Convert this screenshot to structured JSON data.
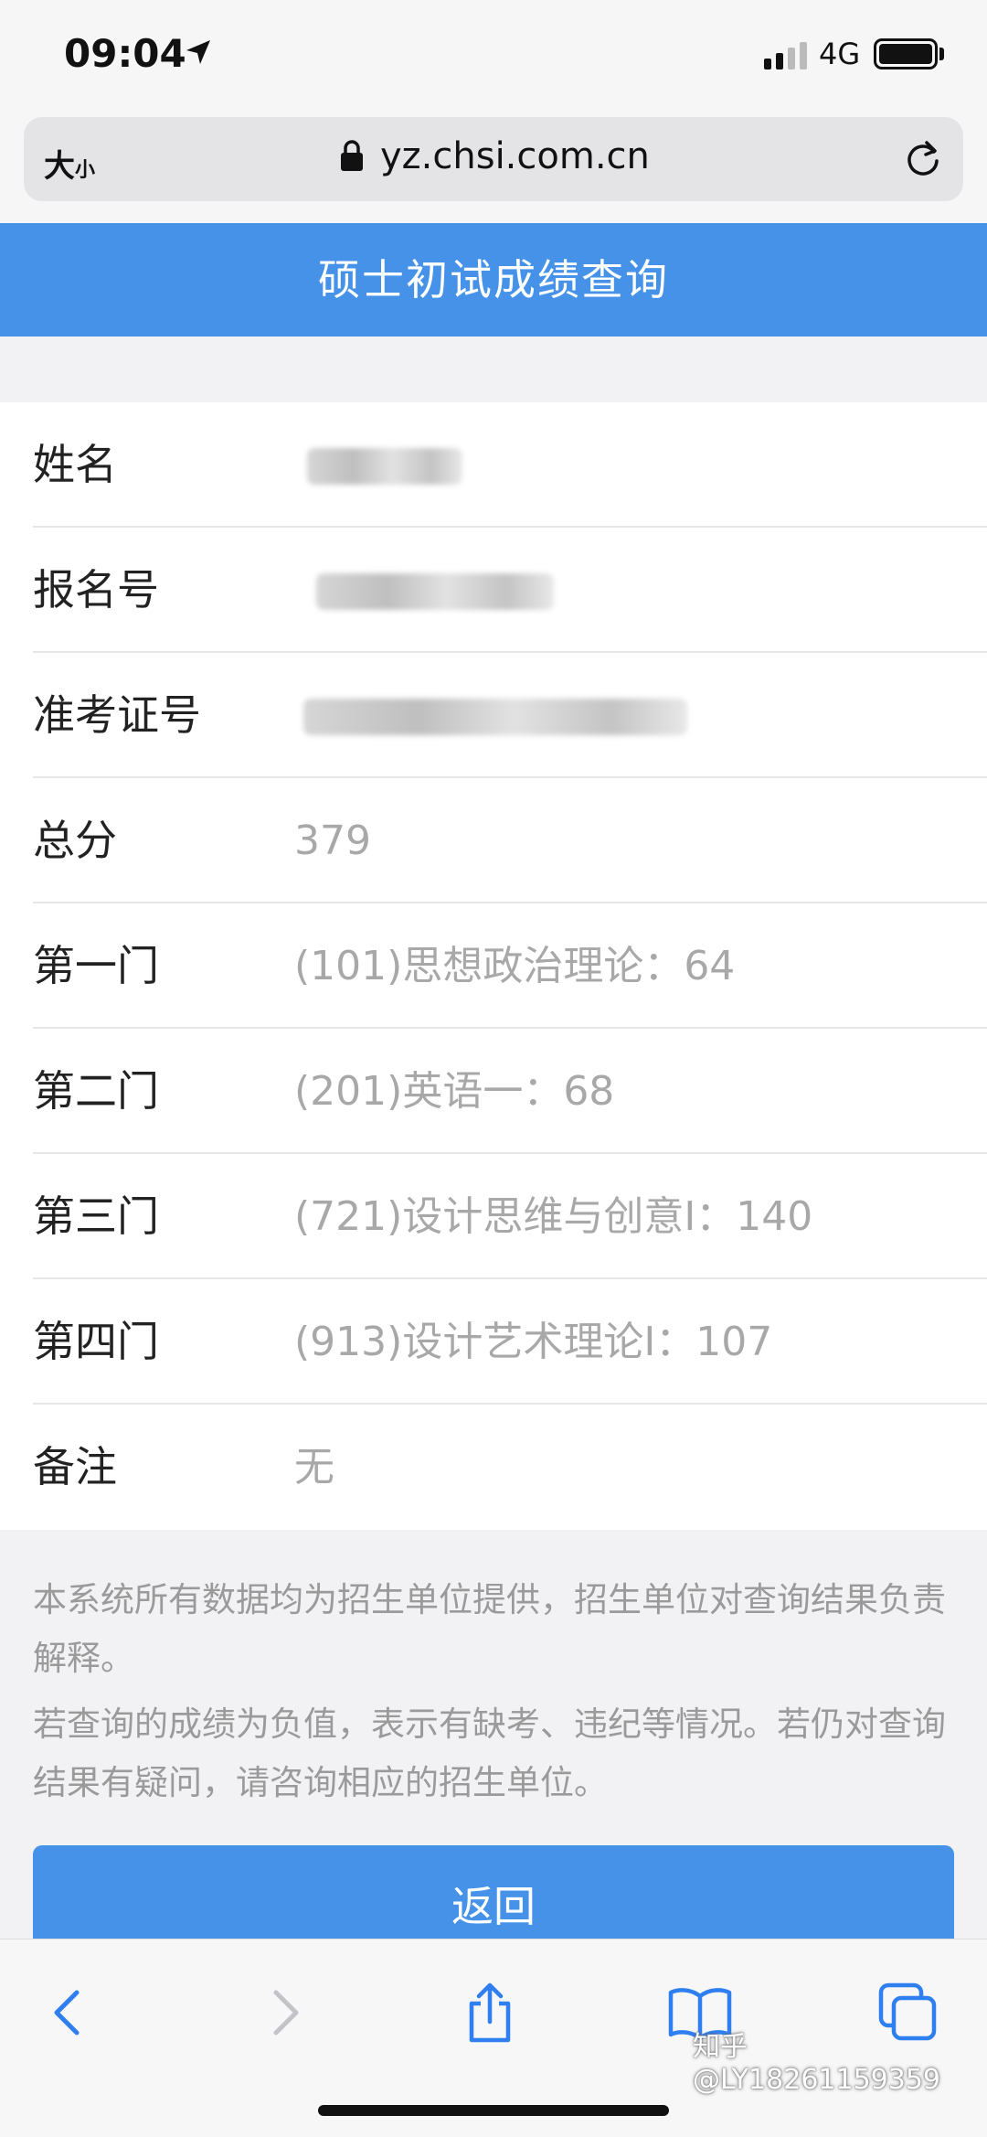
{
  "status_bar": {
    "time": "09:04",
    "network": "4G"
  },
  "browser": {
    "text_size_big": "大",
    "text_size_small": "小",
    "url": "yz.chsi.com.cn"
  },
  "header": {
    "title": "硕士初试成绩查询"
  },
  "rows": [
    {
      "label": "姓名",
      "value": ""
    },
    {
      "label": "报名号",
      "value": ""
    },
    {
      "label": "准考证号",
      "value": ""
    },
    {
      "label": "总分",
      "value": "379"
    },
    {
      "label": "第一门",
      "value": "(101)思想政治理论：64"
    },
    {
      "label": "第二门",
      "value": "(201)英语一：68"
    },
    {
      "label": "第三门",
      "value": "(721)设计思维与创意I：140"
    },
    {
      "label": "第四门",
      "value": "(913)设计艺术理论I：107"
    },
    {
      "label": "备注",
      "value": "无"
    }
  ],
  "notes": [
    "本系统所有数据均为招生单位提供，招生单位对查询结果负责解释。",
    "若查询的成绩为负值，表示有缺考、违纪等情况。若仍对查询结果有疑问，请咨询相应的招生单位。"
  ],
  "back_button": {
    "label": "返回"
  },
  "watermark": "知乎 @LY18261159359",
  "colors": {
    "accent": "#4592e8"
  }
}
